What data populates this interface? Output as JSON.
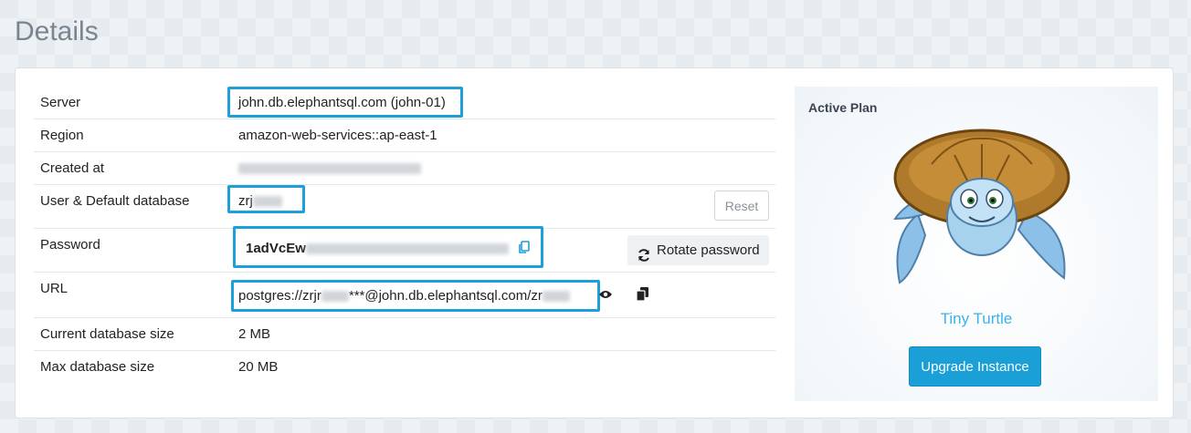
{
  "page": {
    "title": "Details"
  },
  "details": {
    "server": {
      "label": "Server",
      "value": "john.db.elephantsql.com (john-01)"
    },
    "region": {
      "label": "Region",
      "value": "amazon-web-services::ap-east-1"
    },
    "created_at": {
      "label": "Created at"
    },
    "user": {
      "label": "User & Default database",
      "value_prefix": "zrj",
      "reset_label": "Reset"
    },
    "password": {
      "label": "Password",
      "value_prefix": "1adVcEw",
      "rotate_label": "Rotate password"
    },
    "url": {
      "label": "URL",
      "value_part1": "postgres://zrjr",
      "value_part2": "***@john.db.elephantsql.com/zr"
    },
    "db_size": {
      "label": "Current database size",
      "value": "2 MB"
    },
    "max_size": {
      "label": "Max database size",
      "value": "20 MB"
    }
  },
  "plan": {
    "title": "Active Plan",
    "name": "Tiny Turtle",
    "upgrade_label": "Upgrade Instance",
    "mascot_icon": "turtle-mascot"
  },
  "colors": {
    "highlight": "#1d9fdc",
    "accent": "#1a9fd6",
    "plan_name": "#3cb3e6"
  },
  "icons": {
    "copy": "copy-icon",
    "refresh": "refresh-icon",
    "eye": "eye-icon"
  }
}
